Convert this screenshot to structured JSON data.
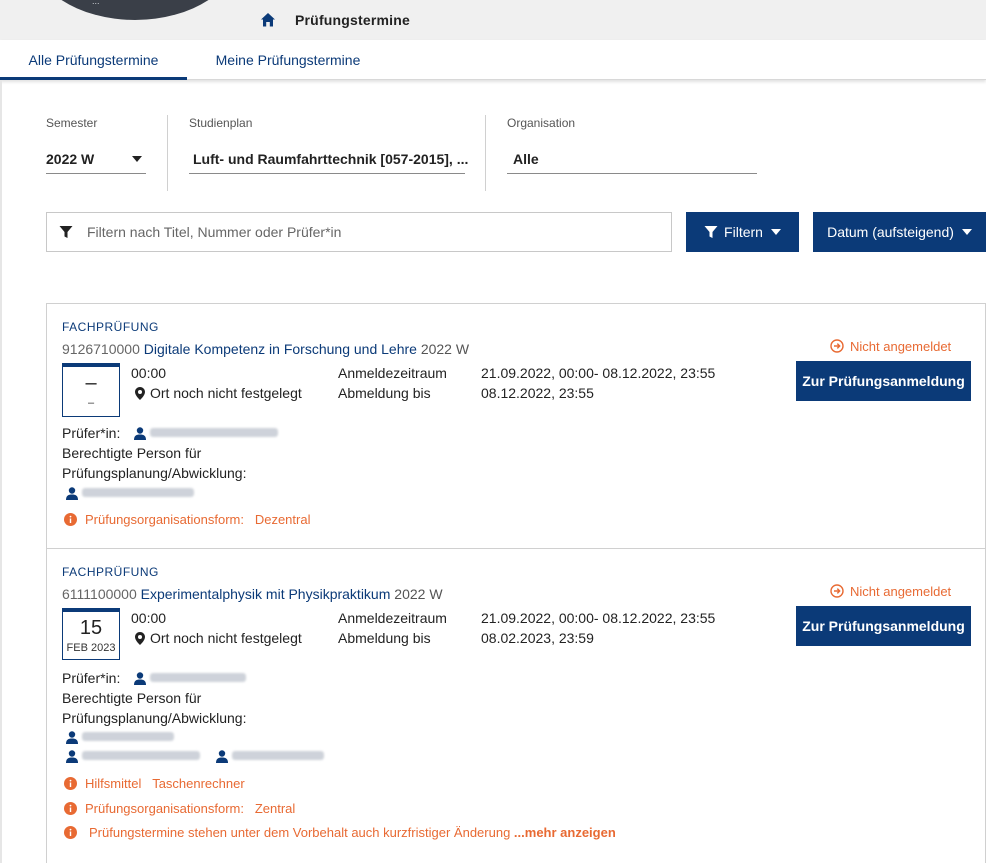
{
  "header": {
    "page_title": "Prüfungstermine",
    "logo_text": "..."
  },
  "tabs": [
    {
      "label": "Alle Prüfungstermine",
      "active": true
    },
    {
      "label": "Meine Prüfungstermine",
      "active": false
    }
  ],
  "filters": {
    "semester": {
      "label": "Semester",
      "value": "2022 W"
    },
    "studienplan": {
      "label": "Studienplan",
      "value": "Luft- und Raumfahrttechnik [057-2015], ..."
    },
    "organisation": {
      "label": "Organisation",
      "value": "Alle"
    },
    "search_placeholder": "Filtern nach Titel, Nummer oder Prüfer*in",
    "filter_button": "Filtern",
    "sort_button": "Datum (aufsteigend)"
  },
  "labels": {
    "examiner": "Prüfer*in:",
    "authorized_line1": "Berechtigte Person für",
    "authorized_line2": "Prüfungsplanung/Abwicklung:",
    "registration_period": "Anmeldezeitraum",
    "deregistration": "Abmeldung bis",
    "register_button": "Zur Prüfungsanmeldung",
    "not_registered": "Nicht angemeldet",
    "org_form": "Prüfungsorganisationsform:",
    "aids": "Hilfsmittel"
  },
  "exams": [
    {
      "type": "FACHPRÜFUNG",
      "number": "9126710000",
      "title": "Digitale Kompetenz in Forschung und Lehre",
      "semester": "2022 W",
      "date_day": "–",
      "date_month": "–",
      "time": "00:00",
      "location": "Ort noch nicht festgelegt",
      "registration_period": "21.09.2022, 00:00- 08.12.2022, 23:55",
      "deregistration_until": "08.12.2022, 23:55",
      "org_form": "Dezentral"
    },
    {
      "type": "FACHPRÜFUNG",
      "number": "6111100000",
      "title": "Experimentalphysik mit Physikpraktikum",
      "semester": "2022 W",
      "date_day": "15",
      "date_month": "FEB 2023",
      "time": "00:00",
      "location": "Ort noch nicht festgelegt",
      "registration_period": "21.09.2022, 00:00- 08.12.2022, 23:55",
      "deregistration_until": "08.02.2023, 23:59",
      "aids": "Taschenrechner",
      "org_form": "Zentral",
      "notice": "Prüfungstermine stehen unter dem Vorbehalt auch kurzfristiger Änderung",
      "more": "...mehr anzeigen"
    }
  ],
  "colors": {
    "primary": "#0b3a78",
    "accent": "#e86a33"
  }
}
